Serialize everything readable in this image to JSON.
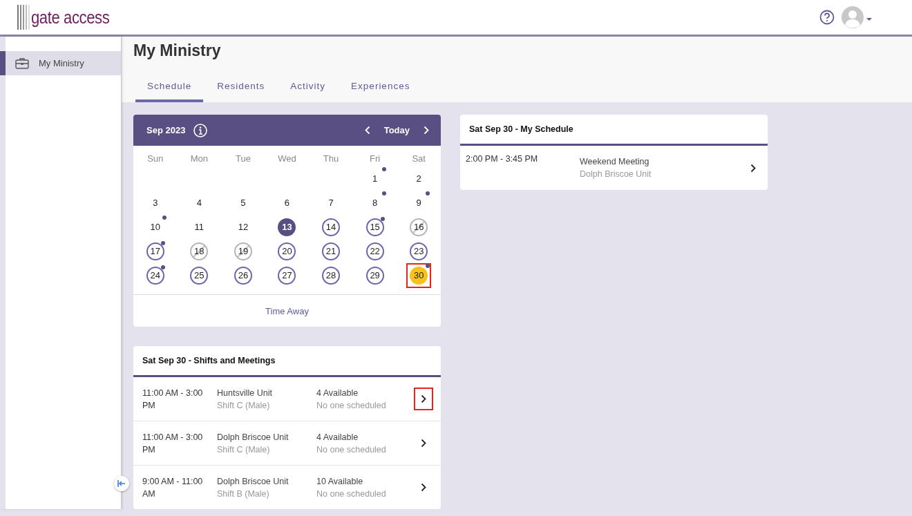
{
  "header": {
    "logo": "gate access"
  },
  "sidebar": {
    "items": [
      {
        "label": "My Ministry",
        "selected": true
      }
    ]
  },
  "page": {
    "title": "My Ministry"
  },
  "tabs": [
    {
      "label": "Schedule",
      "selected": true
    },
    {
      "label": "Residents",
      "selected": false
    },
    {
      "label": "Activity",
      "selected": false
    },
    {
      "label": "Experiences",
      "selected": false
    }
  ],
  "calendar": {
    "month": "Sep 2023",
    "today_button": "Today",
    "weekdays": [
      "Sun",
      "Mon",
      "Tue",
      "Wed",
      "Thu",
      "Fri",
      "Sat"
    ],
    "weeks": [
      [
        {
          "label": "1",
          "kind": "plain",
          "event": true,
          "highlighted": false
        },
        {
          "label": "2",
          "kind": "plain",
          "event": false,
          "highlighted": false
        }
      ],
      [
        {
          "label": "3",
          "kind": "plain",
          "event": false,
          "highlighted": false
        },
        {
          "label": "4",
          "kind": "plain",
          "event": false,
          "highlighted": false
        },
        {
          "label": "5",
          "kind": "plain",
          "event": false,
          "highlighted": false
        },
        {
          "label": "6",
          "kind": "plain",
          "event": false,
          "highlighted": false
        },
        {
          "label": "7",
          "kind": "plain",
          "event": false,
          "highlighted": false
        },
        {
          "label": "8",
          "kind": "plain",
          "event": true,
          "highlighted": false
        },
        {
          "label": "9",
          "kind": "plain",
          "event": true,
          "highlighted": false
        }
      ],
      [
        {
          "label": "10",
          "kind": "plain",
          "event": true,
          "highlighted": false
        },
        {
          "label": "11",
          "kind": "plain",
          "event": false,
          "highlighted": false
        },
        {
          "label": "12",
          "kind": "plain",
          "event": false,
          "highlighted": false
        },
        {
          "label": "13",
          "kind": "today",
          "event": false,
          "highlighted": false
        },
        {
          "label": "14",
          "kind": "open",
          "event": false,
          "highlighted": false
        },
        {
          "label": "15",
          "kind": "open",
          "event": true,
          "highlighted": false
        },
        {
          "label": "16",
          "kind": "unavailable",
          "event": false,
          "highlighted": false
        }
      ],
      [
        {
          "label": "17",
          "kind": "open",
          "event": true,
          "highlighted": false
        },
        {
          "label": "18",
          "kind": "unavailable",
          "event": false,
          "highlighted": false
        },
        {
          "label": "19",
          "kind": "unavailable",
          "event": false,
          "highlighted": false
        },
        {
          "label": "20",
          "kind": "open",
          "event": false,
          "highlighted": false
        },
        {
          "label": "21",
          "kind": "open",
          "event": false,
          "highlighted": false
        },
        {
          "label": "22",
          "kind": "open",
          "event": false,
          "highlighted": false
        },
        {
          "label": "23",
          "kind": "open",
          "event": false,
          "highlighted": false
        }
      ],
      [
        {
          "label": "24",
          "kind": "open",
          "event": true,
          "highlighted": false
        },
        {
          "label": "25",
          "kind": "open",
          "event": false,
          "highlighted": false
        },
        {
          "label": "26",
          "kind": "open",
          "event": false,
          "highlighted": false
        },
        {
          "label": "27",
          "kind": "open",
          "event": false,
          "highlighted": false
        },
        {
          "label": "28",
          "kind": "open",
          "event": false,
          "highlighted": false
        },
        {
          "label": "29",
          "kind": "open",
          "event": false,
          "highlighted": false
        },
        {
          "label": "30",
          "kind": "selected",
          "event": true,
          "highlighted": true
        }
      ]
    ],
    "footer_link": "Time Away"
  },
  "shifts": {
    "title": "Sat Sep 30 - Shifts and Meetings",
    "items": [
      {
        "time": "11:00 AM - 3:00 PM",
        "unit": "Huntsville Unit",
        "shift": "Shift C (Male)",
        "available": "4 Available",
        "status": "No one scheduled",
        "highlighted": true
      },
      {
        "time": "11:00 AM - 3:00 PM",
        "unit": "Dolph Briscoe Unit",
        "shift": "Shift C (Male)",
        "available": "4 Available",
        "status": "No one scheduled",
        "highlighted": false
      },
      {
        "time": "9:00 AM - 11:00 AM",
        "unit": "Dolph Briscoe Unit",
        "shift": "Shift B (Male)",
        "available": "10 Available",
        "status": "No one scheduled",
        "highlighted": false
      }
    ]
  },
  "my_schedule": {
    "title": "Sat Sep 30 - My Schedule",
    "items": [
      {
        "time": "2:00 PM - 3:45 PM",
        "name": "Weekend Meeting",
        "location": "Dolph Briscoe Unit"
      }
    ]
  }
}
